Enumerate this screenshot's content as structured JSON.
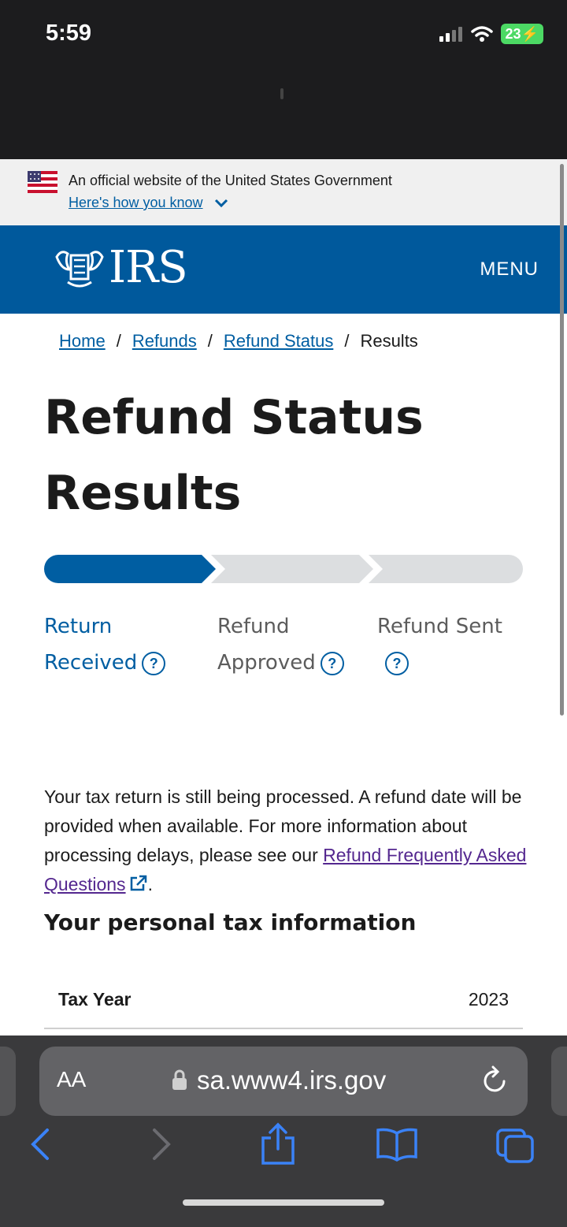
{
  "status_bar": {
    "time": "5:59",
    "battery": "23"
  },
  "gov_banner": {
    "text": "An official website of the United States Government",
    "link": "Here's how you know"
  },
  "header": {
    "logo": "IRS",
    "menu": "MENU",
    "brand_color": "#00599c"
  },
  "breadcrumb": [
    {
      "label": "Home"
    },
    {
      "label": "Refunds"
    },
    {
      "label": "Refund Status"
    },
    {
      "label": "Results"
    }
  ],
  "page_title": "Refund Status Results",
  "progress": {
    "current_step": 1,
    "steps": [
      {
        "line1": "Return",
        "line2": "Received"
      },
      {
        "line1": "Refund",
        "line2": "Approved"
      },
      {
        "line1": "Refund Sent",
        "line2": ""
      }
    ],
    "active_color": "#005ea2",
    "inactive_color": "#dcdee0"
  },
  "message": {
    "text": "Your tax return is still being processed. A refund date will be provided when available. For more information about processing delays, please see our ",
    "link": "Refund Frequently Asked Questions",
    "end": "."
  },
  "section_heading": "Your personal tax information",
  "tax_info": [
    {
      "label": "Tax Year",
      "value": "2023"
    }
  ],
  "safari": {
    "aa": "AA",
    "url": "sa.www4.irs.gov"
  }
}
